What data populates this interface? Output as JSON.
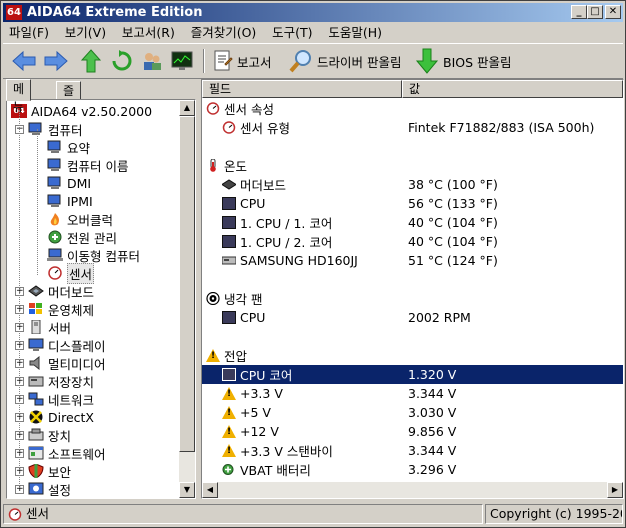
{
  "window": {
    "title": "AIDA64 Extreme Edition",
    "icon_text": "64",
    "controls": {
      "minimize": "_",
      "maximize": "□",
      "close": "✕"
    }
  },
  "menu": [
    "파일(F)",
    "보기(V)",
    "보고서(R)",
    "즐겨찾기(O)",
    "도구(T)",
    "도움말(H)"
  ],
  "toolbar": {
    "report_label": "보고서",
    "driver_update_label": "드라이버 판올림",
    "bios_update_label": "BIOS 판올림"
  },
  "left_tabs": {
    "menu": "메뉴",
    "favorites": "즐겨찾기"
  },
  "tree": {
    "root": "AIDA64 v2.50.2000",
    "computer": "컴퓨터",
    "computer_children": [
      "요약",
      "컴퓨터 이름",
      "DMI",
      "IPMI",
      "오버클럭",
      "전원 관리",
      "이동형 컴퓨터",
      "센서"
    ],
    "top_items": [
      "머더보드",
      "운영체제",
      "서버",
      "디스플레이",
      "멀티미디어",
      "저장장치",
      "네트워크",
      "DirectX",
      "장치",
      "소프트웨어",
      "보안",
      "설정"
    ]
  },
  "columns": {
    "field": "필드",
    "value": "값"
  },
  "sections": [
    {
      "title": "센서 속성",
      "icon": "sensor-gauge-icon",
      "rows": [
        {
          "name": "센서 유형",
          "value": "Fintek F71882/883  (ISA 500h)",
          "icon": "sensor-gauge-icon"
        }
      ]
    },
    {
      "title": "온도",
      "icon": "thermometer-icon",
      "rows": [
        {
          "name": "머더보드",
          "value": "38 °C  (100 °F)",
          "icon": "motherboard-icon"
        },
        {
          "name": "CPU",
          "value": "56 °C  (133 °F)",
          "icon": "cpu-icon"
        },
        {
          "name": "1. CPU / 1. 코어",
          "value": "40 °C  (104 °F)",
          "icon": "cpu-icon"
        },
        {
          "name": "1. CPU / 2. 코어",
          "value": "40 °C  (104 °F)",
          "icon": "cpu-icon"
        },
        {
          "name": "SAMSUNG HD160JJ",
          "value": "51 °C  (124 °F)",
          "icon": "hdd-icon"
        }
      ]
    },
    {
      "title": "냉각 팬",
      "icon": "fan-icon",
      "rows": [
        {
          "name": "CPU",
          "value": "2002 RPM",
          "icon": "cpu-icon"
        }
      ]
    },
    {
      "title": "전압",
      "icon": "warning-icon",
      "rows": [
        {
          "name": "CPU 코어",
          "value": "1.320 V",
          "icon": "cpu-icon",
          "selected": true
        },
        {
          "name": "+3.3 V",
          "value": "3.344 V",
          "icon": "warning-icon"
        },
        {
          "name": "+5 V",
          "value": "3.030 V",
          "icon": "warning-icon"
        },
        {
          "name": "+12 V",
          "value": "9.856 V",
          "icon": "warning-icon"
        },
        {
          "name": "+3.3 V 스탠바이",
          "value": "3.344 V",
          "icon": "warning-icon"
        },
        {
          "name": "VBAT 배터리",
          "value": "3.296 V",
          "icon": "battery-icon"
        }
      ]
    }
  ],
  "status": {
    "left": "센서",
    "right": "Copyright (c) 1995-20"
  },
  "colors": {
    "title_start": "#0a246a",
    "title_end": "#a6caf0",
    "selection": "#0a246a",
    "face": "#d4d0c8"
  }
}
